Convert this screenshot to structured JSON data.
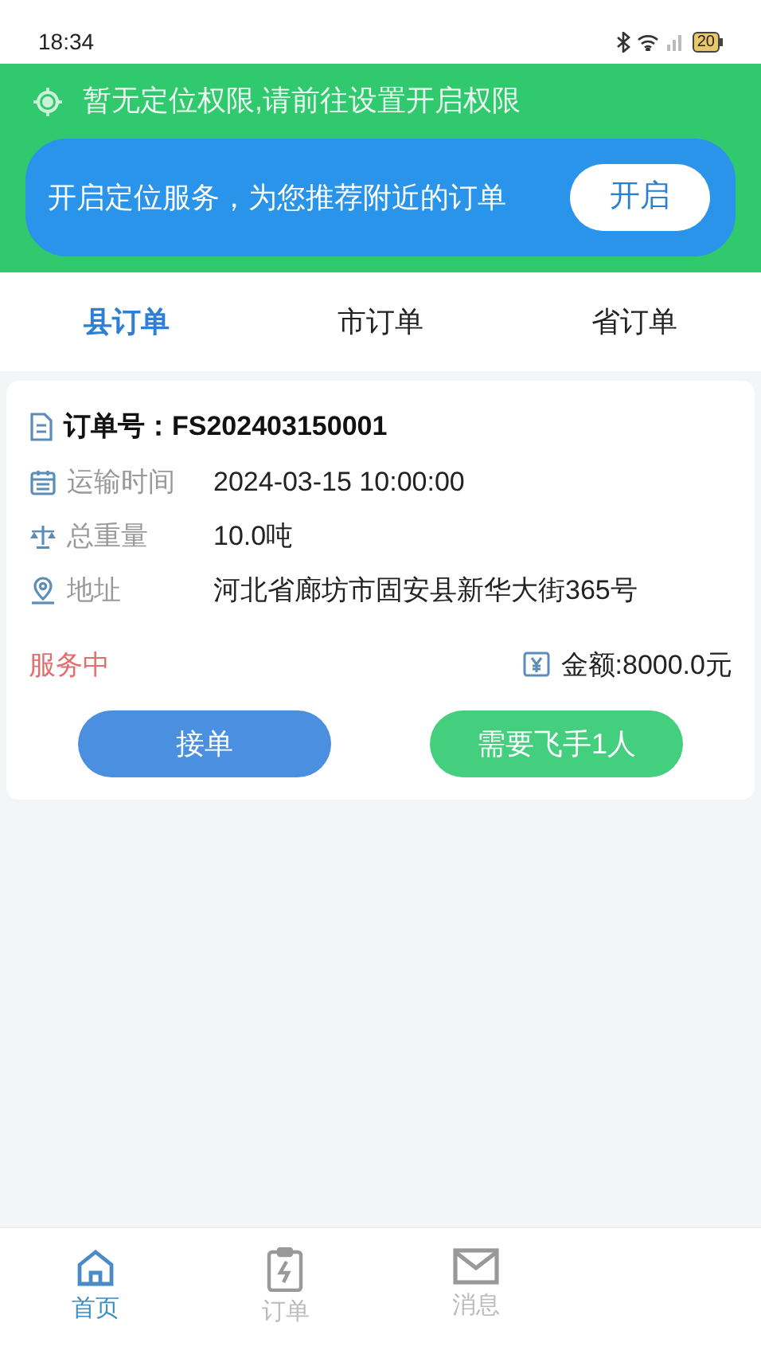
{
  "status_bar": {
    "time": "18:34",
    "battery": "20"
  },
  "location_banner": {
    "notice": "暂无定位权限,请前往设置开启权限",
    "prompt": "开启定位服务，为您推荐附近的订单",
    "button": "开启"
  },
  "tabs": [
    {
      "label": "县订单",
      "selected": true
    },
    {
      "label": "市订单",
      "selected": false
    },
    {
      "label": "省订单",
      "selected": false
    }
  ],
  "orders": [
    {
      "order_no": "订单号：FS202403150001",
      "fields": [
        {
          "kind": "time",
          "label": "运输时间",
          "value": "2024-03-15 10:00:00"
        },
        {
          "kind": "weight",
          "label": "总重量",
          "value": "10.0吨"
        },
        {
          "kind": "address",
          "label": "地址",
          "value": "河北省廊坊市固安县新华大街365号"
        }
      ],
      "status": "服务中",
      "amount": "金额:8000.0元",
      "accept_button": "接单",
      "crew_button": "需要飞手1人"
    }
  ],
  "bottom_nav": [
    {
      "kind": "home",
      "label": "首页",
      "selected": true
    },
    {
      "kind": "orders",
      "label": "订单",
      "selected": false
    },
    {
      "kind": "messages",
      "label": "消息",
      "selected": false
    }
  ]
}
